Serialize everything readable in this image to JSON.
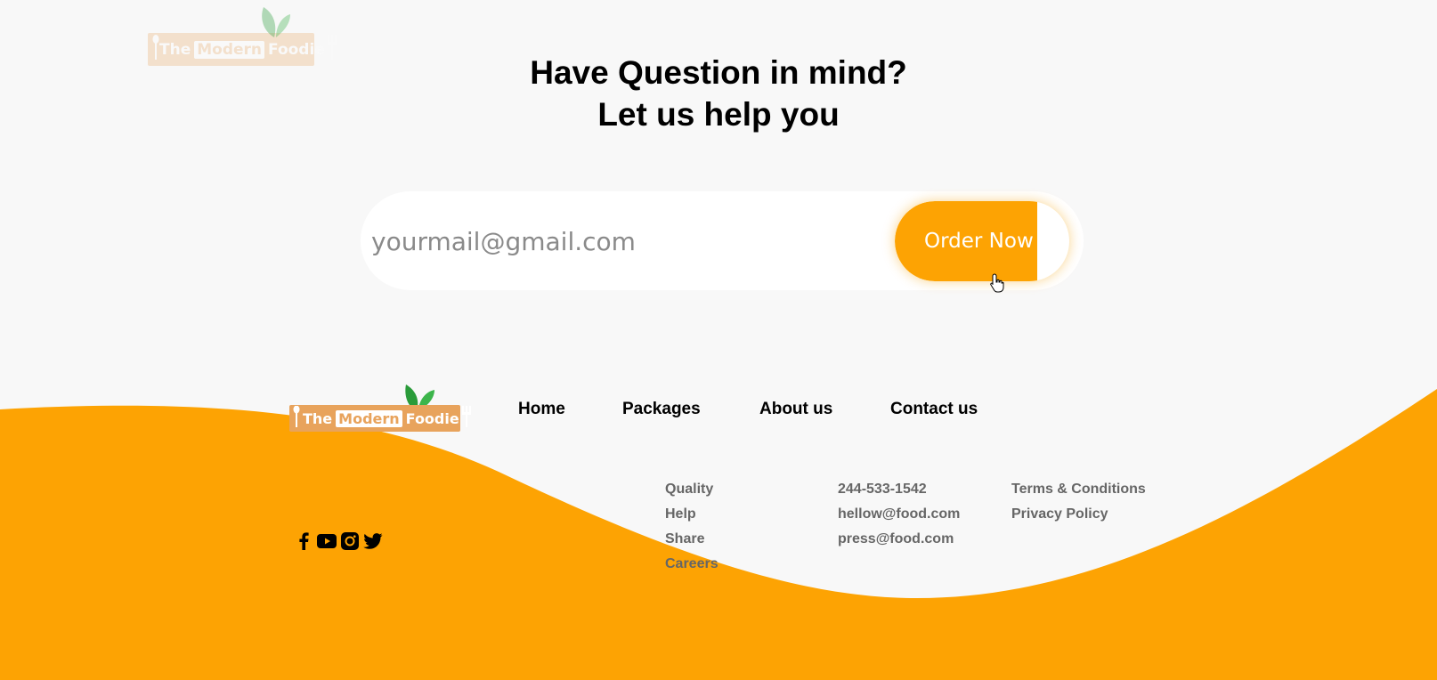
{
  "brand": {
    "name_the": "The",
    "name_modern": "Modern",
    "name_foodie": "Foodie",
    "color_orange": "#fda303",
    "logo_bg": "#e8a35c"
  },
  "hero": {
    "line1": "Have Question in mind?",
    "line2": "Let us help you"
  },
  "subscribe": {
    "email_placeholder": "yourmail@gmail.com",
    "button_label": "Order Now"
  },
  "nav": {
    "home": "Home",
    "packages": "Packages",
    "about": "About us",
    "contact": "Contact us"
  },
  "footer": {
    "col1": [
      "Quality",
      "Help",
      "Share",
      "Careers"
    ],
    "col2": [
      "244-533-1542",
      "hellow@food.com",
      "press@food.com"
    ],
    "col3": [
      "Terms & Conditions",
      "Privacy Policy"
    ],
    "social_icons": [
      "facebook-icon",
      "youtube-icon",
      "instagram-icon",
      "twitter-icon"
    ]
  }
}
